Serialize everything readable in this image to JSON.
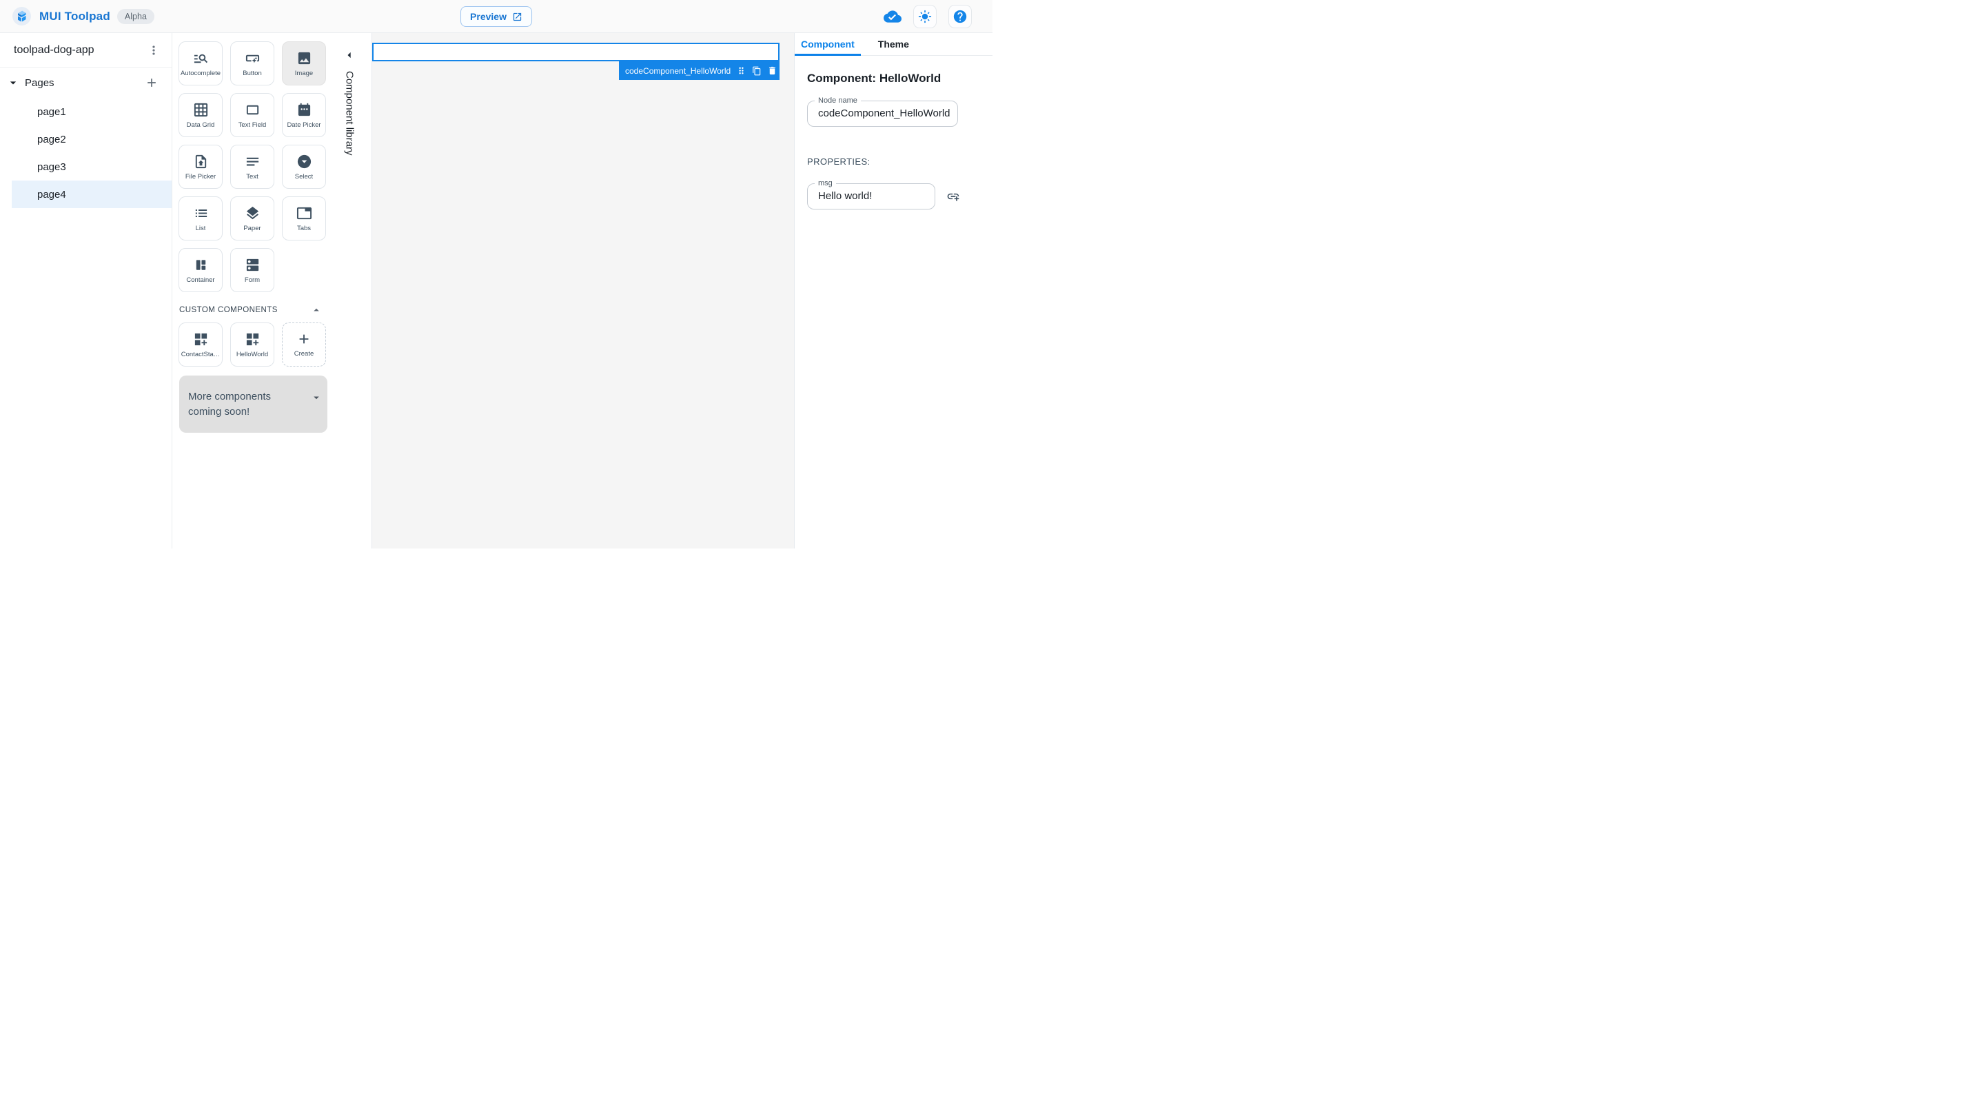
{
  "header": {
    "app_title": "MUI Toolpad",
    "badge": "Alpha",
    "preview_label": "Preview"
  },
  "sidebar": {
    "project_name": "toolpad-dog-app",
    "pages_label": "Pages",
    "pages": [
      {
        "label": "page1",
        "selected": false
      },
      {
        "label": "page2",
        "selected": false
      },
      {
        "label": "page3",
        "selected": false
      },
      {
        "label": "page4",
        "selected": true
      }
    ]
  },
  "library": {
    "panel_label": "Component library",
    "components": [
      {
        "label": "Autocomplete",
        "icon": "manage-search",
        "selected": false
      },
      {
        "label": "Button",
        "icon": "smart-button",
        "selected": false
      },
      {
        "label": "Image",
        "icon": "image",
        "selected": true
      },
      {
        "label": "Data Grid",
        "icon": "grid",
        "selected": false
      },
      {
        "label": "Text Field",
        "icon": "text-field",
        "selected": false
      },
      {
        "label": "Date Picker",
        "icon": "calendar",
        "selected": false
      },
      {
        "label": "File Picker",
        "icon": "file-upload",
        "selected": false
      },
      {
        "label": "Text",
        "icon": "notes",
        "selected": false
      },
      {
        "label": "Select",
        "icon": "select",
        "selected": false
      },
      {
        "label": "List",
        "icon": "list",
        "selected": false
      },
      {
        "label": "Paper",
        "icon": "layers",
        "selected": false
      },
      {
        "label": "Tabs",
        "icon": "tab",
        "selected": false
      },
      {
        "label": "Container",
        "icon": "container",
        "selected": false
      },
      {
        "label": "Form",
        "icon": "dns",
        "selected": false
      }
    ],
    "custom_section_label": "CUSTOM COMPONENTS",
    "custom_components": [
      {
        "label": "ContactSta…",
        "icon": "dashboard-customize",
        "selected": false
      },
      {
        "label": "HelloWorld",
        "icon": "dashboard-customize",
        "selected": false
      }
    ],
    "create_label": "Create",
    "coming_soon_text": "More components coming soon!"
  },
  "canvas": {
    "selected_node_label": "codeComponent_HelloWorld"
  },
  "inspector": {
    "tabs": [
      {
        "label": "Component",
        "selected": true
      },
      {
        "label": "Theme",
        "selected": false
      }
    ],
    "heading": "Component: HelloWorld",
    "node_name_label": "Node name",
    "node_name_value": "codeComponent_HelloWorld",
    "properties_label": "PROPERTIES:",
    "msg_label": "msg",
    "msg_value": "Hello world!"
  },
  "colors": {
    "accent": "#1485e8",
    "brand": "#1976d2",
    "canvas_bg": "#f5f5f5",
    "selected_page_bg": "#e8f2fc"
  }
}
